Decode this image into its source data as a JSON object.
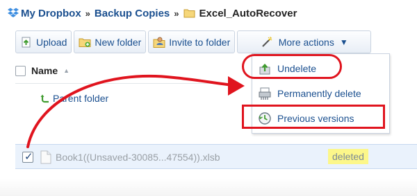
{
  "breadcrumb": {
    "root": "My Dropbox",
    "sep1": "»",
    "folder": "Backup Copies",
    "sep2": "»",
    "current": "Excel_AutoRecover"
  },
  "toolbar": {
    "upload": "Upload",
    "new_folder": "New folder",
    "invite": "Invite to folder",
    "more_actions": "More actions"
  },
  "list": {
    "column_name": "Name",
    "parent_folder": "Parent folder"
  },
  "menu": {
    "undelete": "Undelete",
    "permanently_delete": "Permanently delete",
    "previous_versions": "Previous versions"
  },
  "file": {
    "name": "Book1((Unsaved-30085...47554)).xlsb",
    "status": "deleted"
  },
  "colors": {
    "link_blue": "#1a4f8f",
    "highlight_red": "#e0141e",
    "selected_row": "#eaf2fc",
    "badge_yellow": "#fcf78a"
  },
  "icons": [
    "dropbox-icon",
    "folder-icon",
    "upload-icon",
    "new-folder-icon",
    "invite-icon",
    "magic-wand-icon",
    "chevron-down-icon",
    "parent-folder-arrow-icon",
    "undelete-icon",
    "permanently-delete-icon",
    "previous-versions-icon",
    "file-icon",
    "checkbox-checked-icon"
  ]
}
